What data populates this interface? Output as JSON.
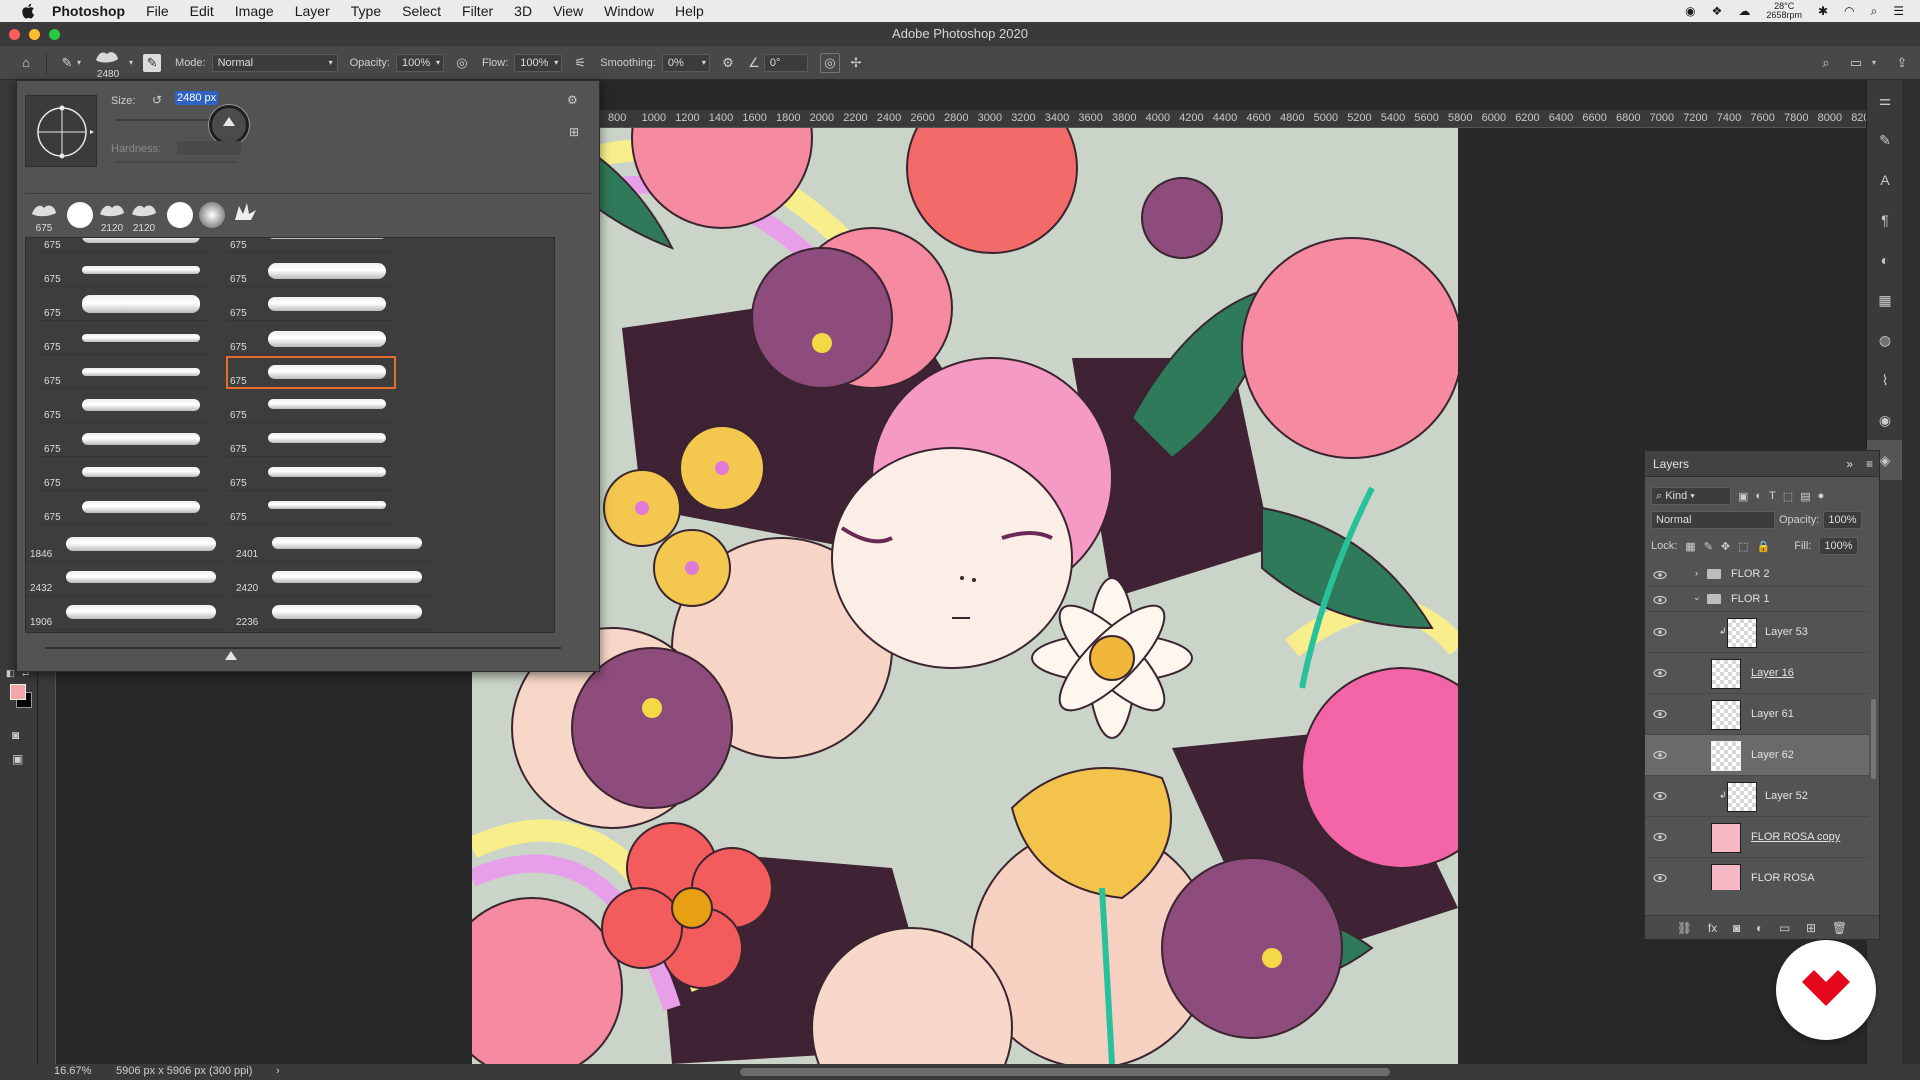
{
  "menubar": {
    "app": "Photoshop",
    "items": [
      "File",
      "Edit",
      "Image",
      "Layer",
      "Type",
      "Select",
      "Filter",
      "3D",
      "View",
      "Window",
      "Help"
    ],
    "weather_temp": "28°C",
    "weather_rpm": "2658rpm"
  },
  "window": {
    "title": "Adobe Photoshop 2020"
  },
  "options": {
    "brush_size": "2480",
    "mode_label": "Mode:",
    "mode_value": "Normal",
    "opacity_label": "Opacity:",
    "opacity_value": "100%",
    "flow_label": "Flow:",
    "flow_value": "100%",
    "smoothing_label": "Smoothing:",
    "smoothing_value": "0%",
    "angle_value": "0°"
  },
  "brush_panel": {
    "size_label": "Size:",
    "size_value": "2480 px",
    "hardness_label": "Hardness:",
    "recent": [
      "675",
      "",
      "2120",
      "2120",
      "",
      "",
      ""
    ],
    "grid_numbers": [
      "675",
      "675",
      "675",
      "675",
      "675",
      "675",
      "675",
      "675",
      "675",
      "675",
      "675",
      "675",
      "675",
      "675",
      "675",
      "675",
      "675",
      "675",
      "675",
      "675"
    ],
    "wide_numbers": [
      "1846",
      "2401",
      "2432",
      "2420",
      "1906",
      "2236"
    ]
  },
  "ruler": {
    "ticks": [
      "800",
      "1000",
      "1200",
      "1400",
      "1600",
      "1800",
      "2000",
      "2200",
      "2400",
      "2600",
      "2800",
      "3000",
      "3200",
      "3400",
      "3600",
      "3800",
      "4000",
      "4200",
      "4400",
      "4600",
      "4800",
      "5000",
      "5200",
      "5400",
      "5600",
      "5800",
      "6000",
      "6200",
      "6400",
      "6600",
      "6800",
      "7000",
      "7200",
      "7400",
      "7600",
      "7800",
      "8000",
      "820"
    ]
  },
  "status": {
    "zoom": "16.67%",
    "doc_info": "5906 px x 5906 px (300 ppi)"
  },
  "layers": {
    "title": "Layers",
    "filter_kind": "Kind",
    "blend_mode": "Normal",
    "opacity_label": "Opacity:",
    "opacity_value": "100%",
    "lock_label": "Lock:",
    "fill_label": "Fill:",
    "fill_value": "100%",
    "rows": [
      {
        "name": "FLOR 2"
      },
      {
        "name": "FLOR 1"
      },
      {
        "name": "Layer 53"
      },
      {
        "name": "Layer 16"
      },
      {
        "name": "Layer 61"
      },
      {
        "name": "Layer 62"
      },
      {
        "name": "Layer 52"
      },
      {
        "name": "FLOR ROSA copy"
      },
      {
        "name": "FLOR ROSA"
      }
    ]
  },
  "colors": {
    "foreground": "#f4a6ad",
    "background": "#000000",
    "selection": "#e46d2c"
  }
}
